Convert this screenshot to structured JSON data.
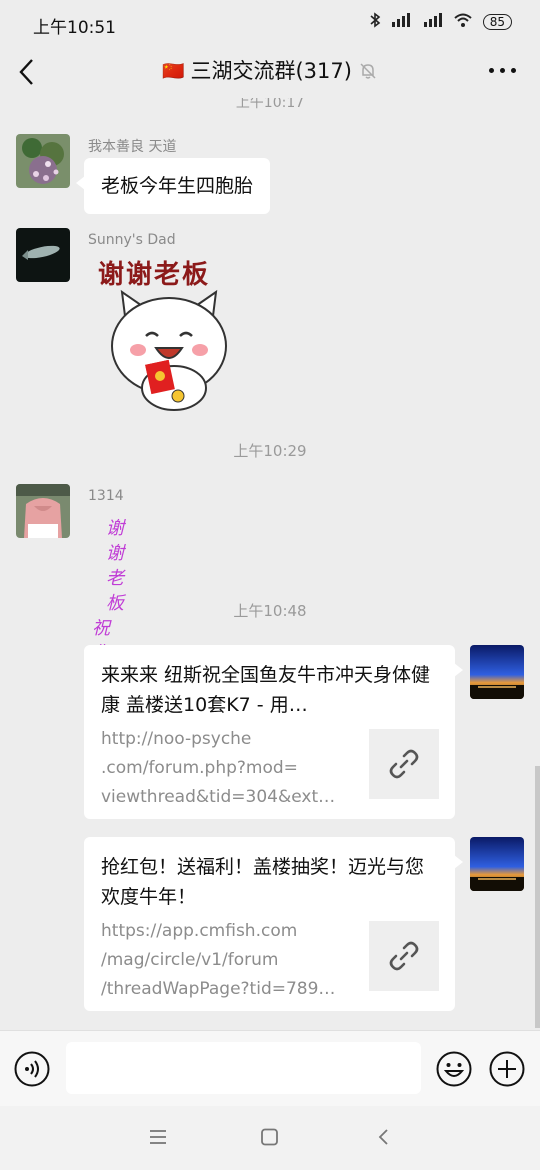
{
  "status_bar": {
    "time": "上午10:51",
    "battery": "85"
  },
  "header": {
    "flag": "🇨🇳",
    "title": "三湖交流群(317)"
  },
  "chat": {
    "partial_timestamp": "上午10:17",
    "messages": [
      {
        "sender": "我本善良 天道",
        "text": "老板今年生四胞胎"
      },
      {
        "sender": "Sunny's Dad",
        "sticker_text": "谢谢老板"
      },
      {
        "timestamp": "上午10:29"
      },
      {
        "sender": "1314",
        "sticker_line1": "谢谢老板",
        "sticker_line2": "祝你啪啪愉快"
      },
      {
        "timestamp": "上午10:48"
      },
      {
        "title": "来来来 纽斯祝全国鱼友牛市冲天身体健康 盖楼送10套K7 - 用…",
        "url_lines": [
          "http://noo-psyche",
          ".com/forum.php?mod=",
          "viewthread&tid=304&ext…"
        ]
      },
      {
        "title": "抢红包！送福利！盖楼抽奖！迈光与您欢度牛年！",
        "url_lines": [
          "https://app.cmfish.com",
          "/mag/circle/v1/forum",
          "/threadWapPage?tid=789…"
        ]
      }
    ]
  },
  "colors": {
    "background": "#ededed",
    "sticker_pink": "#c03cd6",
    "sticker_red": "#8c1a1a"
  }
}
